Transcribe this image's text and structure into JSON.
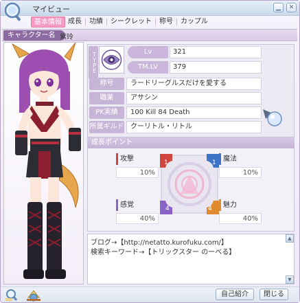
{
  "window": {
    "title": "マイビュー",
    "minimize_icon": "minimize-icon",
    "close_icon": "close-icon"
  },
  "tabs": [
    {
      "label": "基本情報",
      "active": true
    },
    {
      "label": "成長",
      "active": false
    },
    {
      "label": "功績",
      "active": false
    },
    {
      "label": "シークレット",
      "active": false
    },
    {
      "label": "称号",
      "active": false
    },
    {
      "label": "カップル",
      "active": false
    }
  ],
  "character": {
    "name_label": "キャラクター名",
    "name": "紫玲"
  },
  "type_label": "TYPE",
  "stats": {
    "lv_label": "Lv",
    "lv_value": "321",
    "tmlv_label": "TM.LV",
    "tmlv_value": "379"
  },
  "profile": {
    "title_label": "称号",
    "title_value": "ラードリーグルスだけを愛する",
    "job_label": "職業",
    "job_value": "アサシン",
    "pk_label": "PK実績",
    "pk_value": "100 Kill  84 Death",
    "guild_label": "所属ギルド",
    "guild_value": "クーリトル・リトル"
  },
  "growth": {
    "header": "成長ポイント",
    "attack_label": "攻撃",
    "attack_value": "10%",
    "magic_label": "魔法",
    "magic_value": "10%",
    "sense_label": "感覚",
    "sense_value": "40%",
    "charm_label": "魅力",
    "charm_value": "40%",
    "radar_points": {
      "attack": "1",
      "magic": "1",
      "sense": "4",
      "charm": "4"
    }
  },
  "memo": {
    "line1": "ブログ→【http://netatto.kurofuku.com/】",
    "line2": "検索キーワード→【トリックスター のーべる】"
  },
  "buttons": {
    "self_intro": "自己紹介",
    "close": "閉じる"
  },
  "colors": {
    "accent_pink": "#f69bc4",
    "panel_purple": "#c7b5d8",
    "attack_red": "#d0453f",
    "magic_blue": "#3e74c8",
    "sense_purple": "#8a63c7",
    "charm_orange": "#e08a2f"
  }
}
